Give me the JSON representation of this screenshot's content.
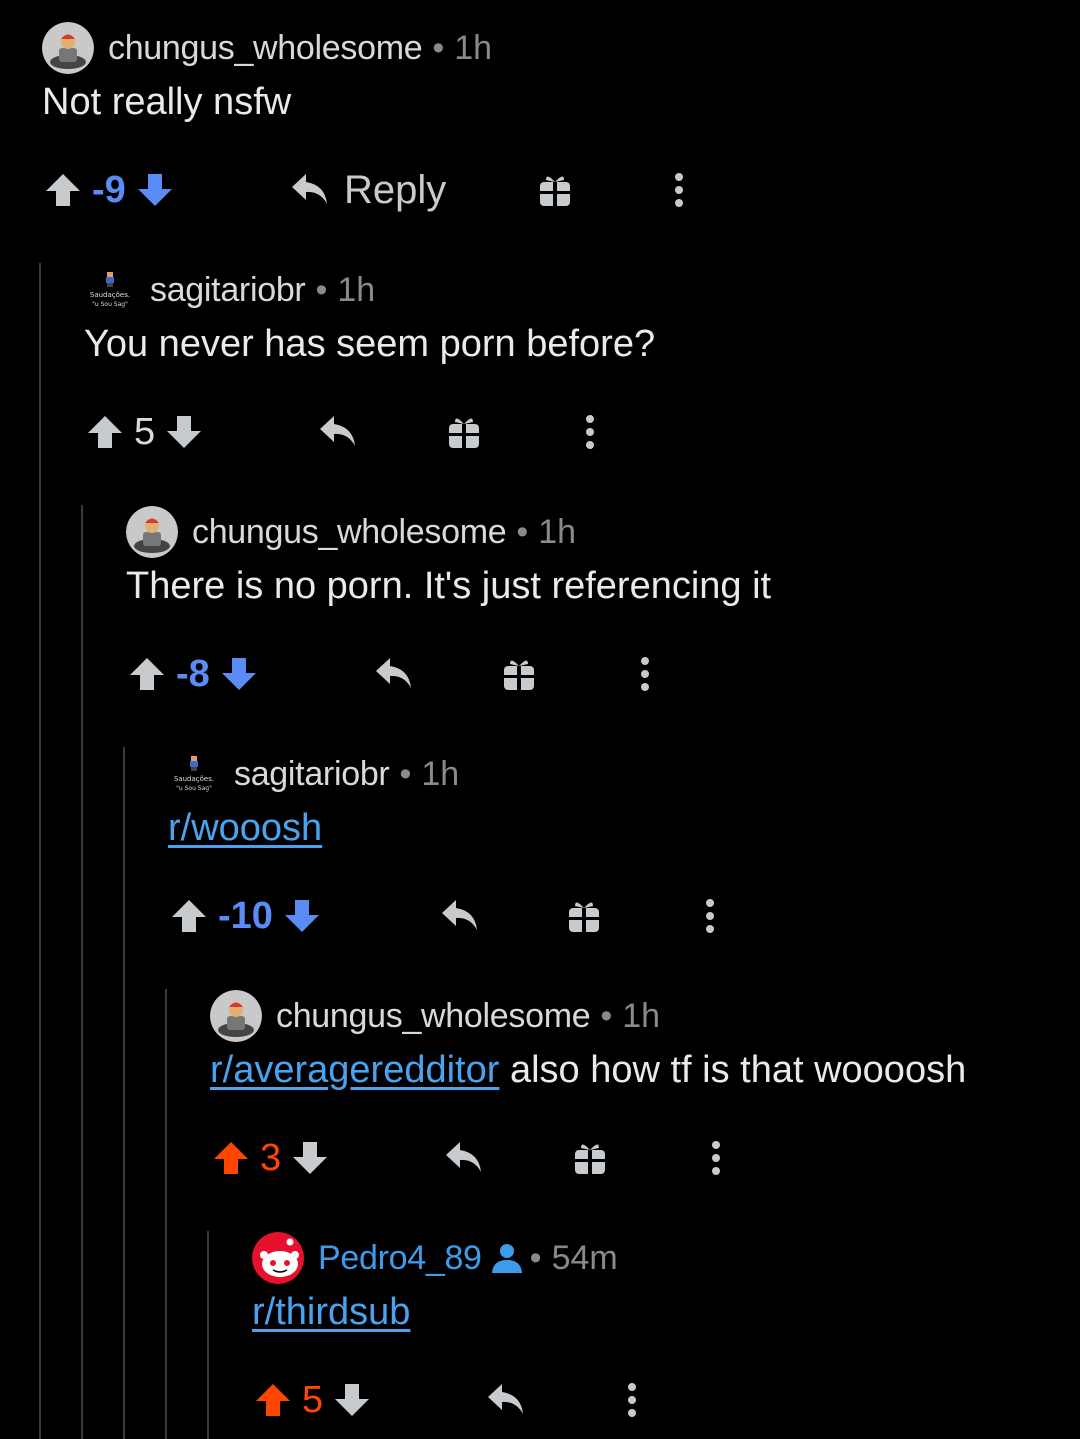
{
  "colors": {
    "background": "#000000",
    "downvote_blue": "#5b8cf5",
    "upvote_orange": "#ff4500",
    "link_blue": "#4aa3ee",
    "thread_line": "#3a3a3c"
  },
  "comments": [
    {
      "username": "chungus_wholesome",
      "time": "1h",
      "text": "Not really nsfw",
      "score": "-9",
      "reply_label": "Reply",
      "vote_state": "downvoted"
    },
    {
      "username": "sagitariobr",
      "time": "1h",
      "text": "You never has seem porn before?",
      "score": "5",
      "vote_state": "none",
      "avatar_text_1": "Saudações.",
      "avatar_text_2": "\"u Sou Sag\""
    },
    {
      "username": "chungus_wholesome",
      "time": "1h",
      "text": "There is no porn. It's just referencing it",
      "score": "-8",
      "vote_state": "downvoted"
    },
    {
      "username": "sagitariobr",
      "time": "1h",
      "link": "r/wooosh",
      "score": "-10",
      "vote_state": "downvoted",
      "avatar_text_1": "Saudações.",
      "avatar_text_2": "\"u Sou Sag\""
    },
    {
      "username": "chungus_wholesome",
      "time": "1h",
      "link": "r/averageredditor",
      "text_after_link": " also how tf is that woooosh",
      "score": "3",
      "vote_state": "upvoted"
    },
    {
      "username": "Pedro4_89",
      "time": "54m",
      "link": "r/thirdsub",
      "score": "5",
      "vote_state": "upvoted",
      "is_op": true
    }
  ],
  "separator": "•"
}
